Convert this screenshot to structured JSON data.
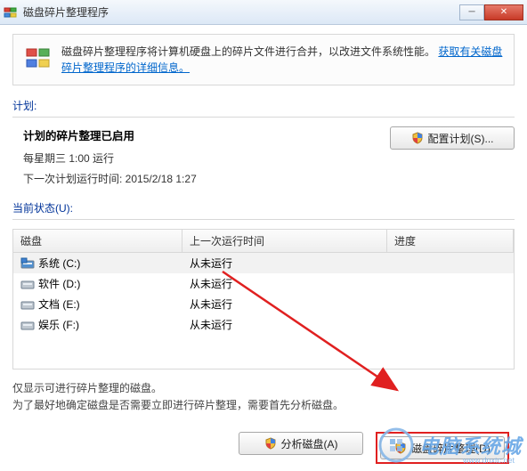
{
  "window": {
    "title": "磁盘碎片整理程序"
  },
  "info": {
    "text_prefix": "磁盘碎片整理程序将计算机硬盘上的碎片文件进行合并，以改进文件系统性能。",
    "link": "获取有关磁盘碎片整理程序的详细信息。"
  },
  "sections": {
    "schedule_label": "计划:",
    "status_label": "当前状态(U):"
  },
  "schedule": {
    "enabled_text": "计划的碎片整理已启用",
    "frequency_text": "每星期三  1:00 运行",
    "next_run_text": "下一次计划运行时间: 2015/2/18 1:27",
    "config_button": "配置计划(S)..."
  },
  "table": {
    "headers": {
      "disk": "磁盘",
      "last": "上一次运行时间",
      "progress": "进度"
    },
    "rows": [
      {
        "name": "系统 (C:)",
        "last": "从未运行",
        "type": "sys"
      },
      {
        "name": "软件 (D:)",
        "last": "从未运行",
        "type": "hdd"
      },
      {
        "name": "文档 (E:)",
        "last": "从未运行",
        "type": "hdd"
      },
      {
        "name": "娱乐 (F:)",
        "last": "从未运行",
        "type": "hdd"
      }
    ]
  },
  "note": {
    "line1": "仅显示可进行碎片整理的磁盘。",
    "line2": "为了最好地确定磁盘是否需要立即进行碎片整理，需要首先分析磁盘。"
  },
  "buttons": {
    "analyze": "分析磁盘(A)",
    "defrag": "磁盘碎片整理(D)"
  },
  "watermark": {
    "text": "电脑系统城",
    "sub": "www.dnxtc.net"
  }
}
